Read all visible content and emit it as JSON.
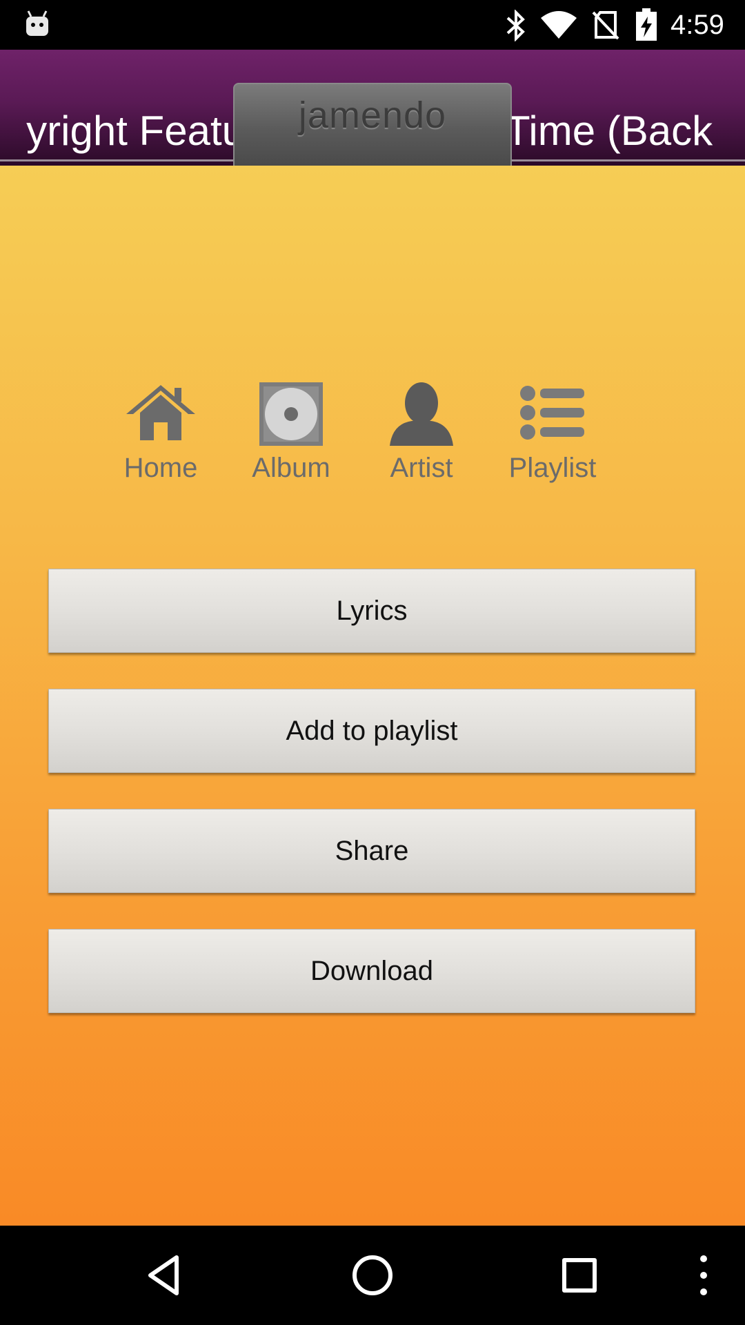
{
  "status_bar": {
    "time": "4:59",
    "icons": [
      "android-icon",
      "bluetooth-icon",
      "wifi-icon",
      "no-sim-icon",
      "battery-icon"
    ]
  },
  "header": {
    "marquee_left": "yright Featu",
    "marquee_right": "Time (Back",
    "logo": "jamendo"
  },
  "nav": {
    "items": [
      {
        "label": "Home",
        "icon": "home-icon"
      },
      {
        "label": "Album",
        "icon": "album-icon"
      },
      {
        "label": "Artist",
        "icon": "artist-icon"
      },
      {
        "label": "Playlist",
        "icon": "playlist-icon"
      }
    ]
  },
  "actions": {
    "lyrics": "Lyrics",
    "add_to_playlist": "Add to playlist",
    "share": "Share",
    "download": "Download"
  },
  "colors": {
    "header_purple": "#6f2269",
    "background_top": "#f6cd55",
    "background_bottom": "#f98a26",
    "icon_gray": "#6b6b6b"
  },
  "system_nav": {
    "icons": [
      "back-icon",
      "home-circle-icon",
      "recents-icon",
      "overflow-menu-icon"
    ]
  }
}
